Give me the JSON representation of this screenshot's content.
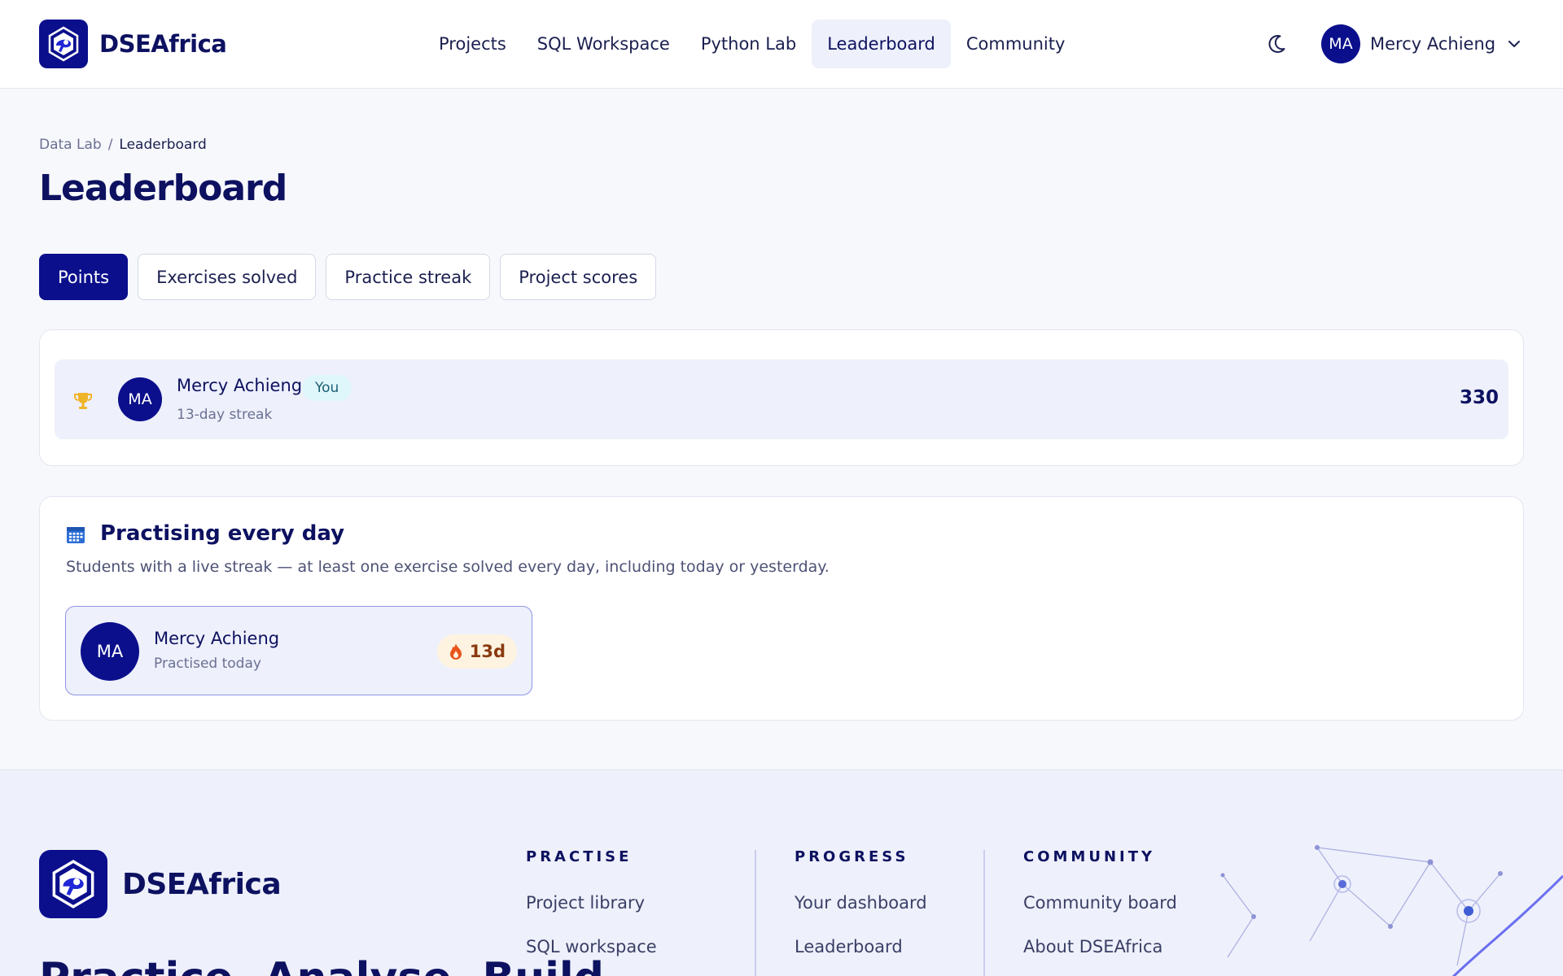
{
  "header": {
    "brand": "DSEAfrica",
    "nav": [
      {
        "label": "Projects",
        "active": false
      },
      {
        "label": "SQL Workspace",
        "active": false
      },
      {
        "label": "Python Lab",
        "active": false
      },
      {
        "label": "Leaderboard",
        "active": true
      },
      {
        "label": "Community",
        "active": false
      }
    ],
    "theme_icon": "moon-icon",
    "user": {
      "initials": "MA",
      "name": "Mercy Achieng"
    }
  },
  "breadcrumb": {
    "parent": "Data Lab",
    "separator": "/",
    "current": "Leaderboard"
  },
  "page_title": "Leaderboard",
  "tabs": [
    {
      "label": "Points",
      "active": true
    },
    {
      "label": "Exercises solved",
      "active": false
    },
    {
      "label": "Practice streak",
      "active": false
    },
    {
      "label": "Project scores",
      "active": false
    }
  ],
  "leaderboard": {
    "rows": [
      {
        "rank_icon": "trophy-icon",
        "initials": "MA",
        "name": "Mercy Achieng",
        "badge": "You",
        "subtitle": "13-day streak",
        "points": "330"
      }
    ]
  },
  "practising": {
    "icon": "calendar-icon",
    "title": "Practising every day",
    "description": "Students with a live streak — at least one exercise solved every day, including today or yesterday.",
    "students": [
      {
        "initials": "MA",
        "name": "Mercy Achieng",
        "subtitle": "Practised today",
        "streak": "13d"
      }
    ]
  },
  "footer": {
    "brand": "DSEAfrica",
    "tagline": "Practice. Analyse. Build.",
    "columns": [
      {
        "heading": "PRACTISE",
        "links": [
          "Project library",
          "SQL workspace"
        ]
      },
      {
        "heading": "PROGRESS",
        "links": [
          "Your dashboard",
          "Leaderboard"
        ]
      },
      {
        "heading": "COMMUNITY",
        "links": [
          "Community board",
          "About DSEAfrica"
        ]
      }
    ]
  },
  "colors": {
    "brand_navy": "#0b0f8c",
    "active_bg": "#eef0fb",
    "badge_bg": "#dff6fb",
    "streak_bg": "#fdf3e0",
    "trophy": "#f0b429",
    "flame": "#e8541c"
  }
}
